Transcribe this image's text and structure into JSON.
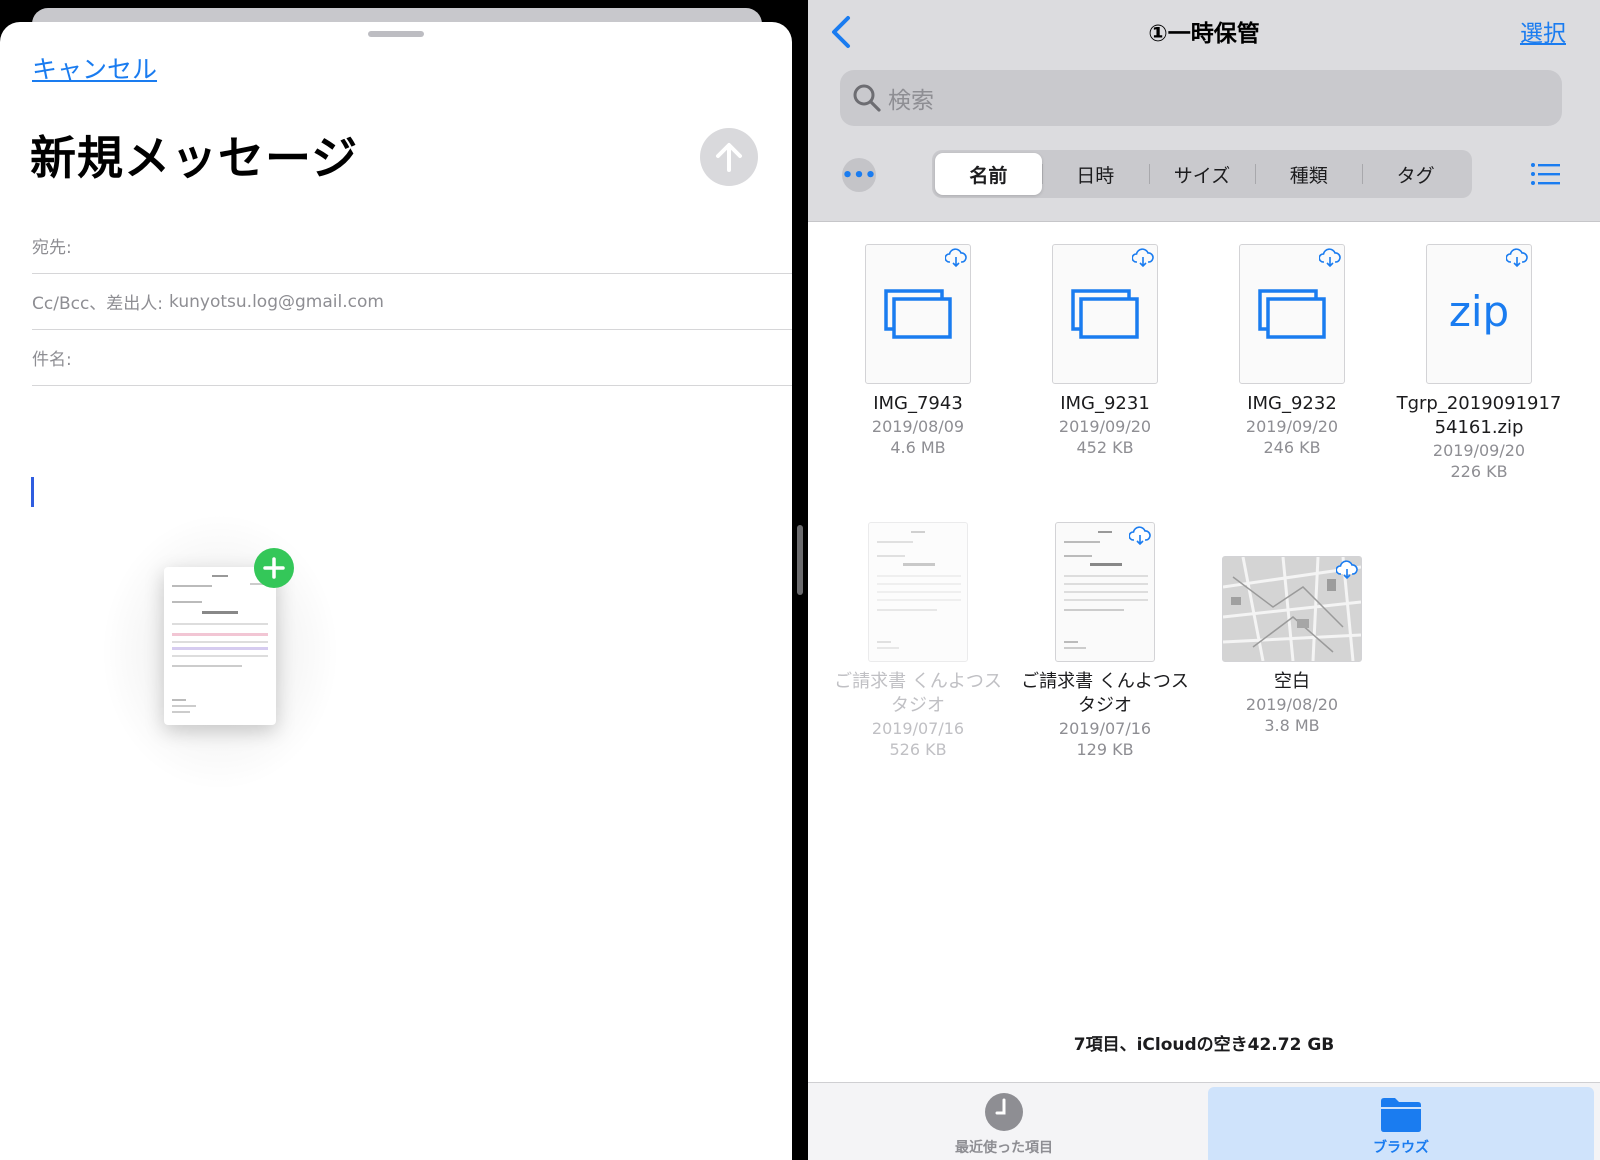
{
  "mail": {
    "cancel_label": "キャンセル",
    "title": "新規メッセージ",
    "to_label": "宛先:",
    "cc_label": "Cc/Bcc、差出人:",
    "cc_value": "kunyotsu.log@gmail.com",
    "subject_label": "件名:",
    "send_icon": "arrow-up-icon",
    "drag_badge_icon": "plus-icon"
  },
  "files": {
    "folder_title": "①一時保管",
    "select_label": "選択",
    "search_placeholder": "検索",
    "sort_tabs": [
      {
        "label": "名前",
        "active": true
      },
      {
        "label": "日時",
        "active": false
      },
      {
        "label": "サイズ",
        "active": false
      },
      {
        "label": "種類",
        "active": false
      },
      {
        "label": "タグ",
        "active": false
      }
    ],
    "items": [
      {
        "name": "IMG_7943",
        "date": "2019/08/09",
        "size": "4.6 MB",
        "kind": "folder-doc",
        "cloud": true
      },
      {
        "name": "IMG_9231",
        "date": "2019/09/20",
        "size": "452 KB",
        "kind": "folder-doc",
        "cloud": true
      },
      {
        "name": "IMG_9232",
        "date": "2019/09/20",
        "size": "246 KB",
        "kind": "folder-doc",
        "cloud": true
      },
      {
        "name_line1": "Tgrp_2019091917",
        "name_line2": "54161.zip",
        "date": "2019/09/20",
        "size": "226 KB",
        "kind": "zip",
        "zip_label": "zip",
        "cloud": true
      },
      {
        "name_line1": "ご請求書 くんよつス",
        "name_line2": "タジオ",
        "date": "2019/07/16",
        "size": "526 KB",
        "kind": "invoice",
        "cloud": false,
        "dimmed": true
      },
      {
        "name_line1": "ご請求書 くんよつス",
        "name_line2": "タジオ",
        "date": "2019/07/16",
        "size": "129 KB",
        "kind": "invoice",
        "cloud": true
      },
      {
        "name": "空白",
        "date": "2019/08/20",
        "size": "3.8 MB",
        "kind": "map",
        "cloud": true
      }
    ],
    "summary": "7項目、iCloudの空き42.72 GB",
    "tabs": {
      "recent_label": "最近使った項目",
      "browse_label": "ブラウズ"
    },
    "accent_color": "#1a7cf0"
  }
}
